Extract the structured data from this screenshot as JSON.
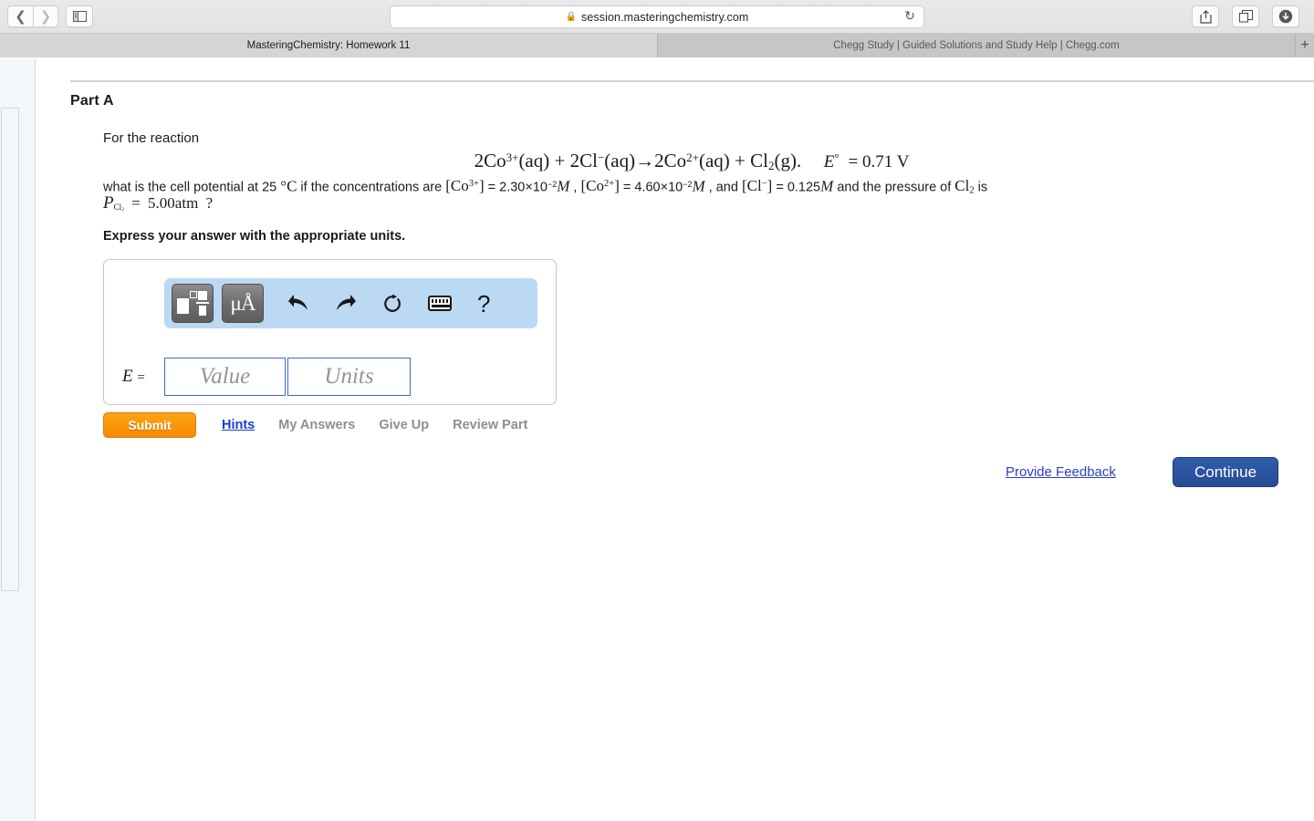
{
  "browser": {
    "url": "session.masteringchemistry.com",
    "lock_icon": "lock-icon",
    "reload_icon": "reload-icon",
    "back_icon": "chevron-left-icon",
    "forward_icon": "chevron-right-icon",
    "sidebar_icon": "sidebar-panel-icon",
    "share_icon": "share-upload-icon",
    "tabs_icon": "tab-overview-icon",
    "download_icon": "download-arrow-icon",
    "new_tab_label": "+",
    "tabs": [
      {
        "title": "MasteringChemistry: Homework 11",
        "active": true
      },
      {
        "title": "Chegg Study | Guided Solutions and Study Help | Chegg.com",
        "active": false
      }
    ]
  },
  "question": {
    "part_title": "Part A",
    "prompt_intro": "For the reaction",
    "equation_plain": "2Co3+(aq) + 2Cl-(aq)→2Co2+(aq) + Cl2(g).   E° = 0.71 V",
    "equation_standard_potential": "0.71 V",
    "prompt_body_plain": "what is the cell potential at 25 °C if the concentrations are [Co3+] = 2.30×10-2 M , [Co2+] = 4.60×10-2 M , and [Cl-] = 0.125 M and the pressure of Cl2 is",
    "prompt_pressure_plain": "PCl2 = 5.00 atm ?",
    "temperature": "25",
    "temperature_unit": "°C",
    "conc_co3": "2.30×10",
    "conc_co3_exp": "-2",
    "conc_co2": "4.60×10",
    "conc_co2_exp": "-2",
    "conc_cl": "0.125",
    "pressure_value": "5.00atm",
    "instruction": "Express your answer with the appropriate units."
  },
  "answer_card": {
    "toolbar": {
      "template_icon": "math-template-icon",
      "units_icon": "micro-angstrom-units-icon",
      "units_glyph": "μÅ",
      "undo_icon": "undo-arrow-icon",
      "undo_glyph": "↰",
      "redo_icon": "redo-arrow-icon",
      "redo_glyph": "↱",
      "reset_icon": "reset-circular-arrow-icon",
      "reset_glyph": "↻",
      "keyboard_icon": "keyboard-icon",
      "help_icon": "help-question-icon",
      "help_glyph": "?"
    },
    "variable_label": "E =",
    "value_placeholder": "Value",
    "units_placeholder": "Units",
    "value_current": "",
    "units_current": ""
  },
  "actions": {
    "submit_label": "Submit",
    "hints_label": "Hints",
    "my_answers_label": "My Answers",
    "give_up_label": "Give Up",
    "review_part_label": "Review Part"
  },
  "footer": {
    "feedback_label": "Provide Feedback",
    "continue_label": "Continue"
  },
  "colors": {
    "submit_orange": "#f58a07",
    "continue_blue": "#2f5cab",
    "link_blue": "#1a3fd0",
    "toolbar_blue": "#bcd9f4",
    "field_border_blue": "#4169c9",
    "rail_bg": "#f2f7fc"
  }
}
